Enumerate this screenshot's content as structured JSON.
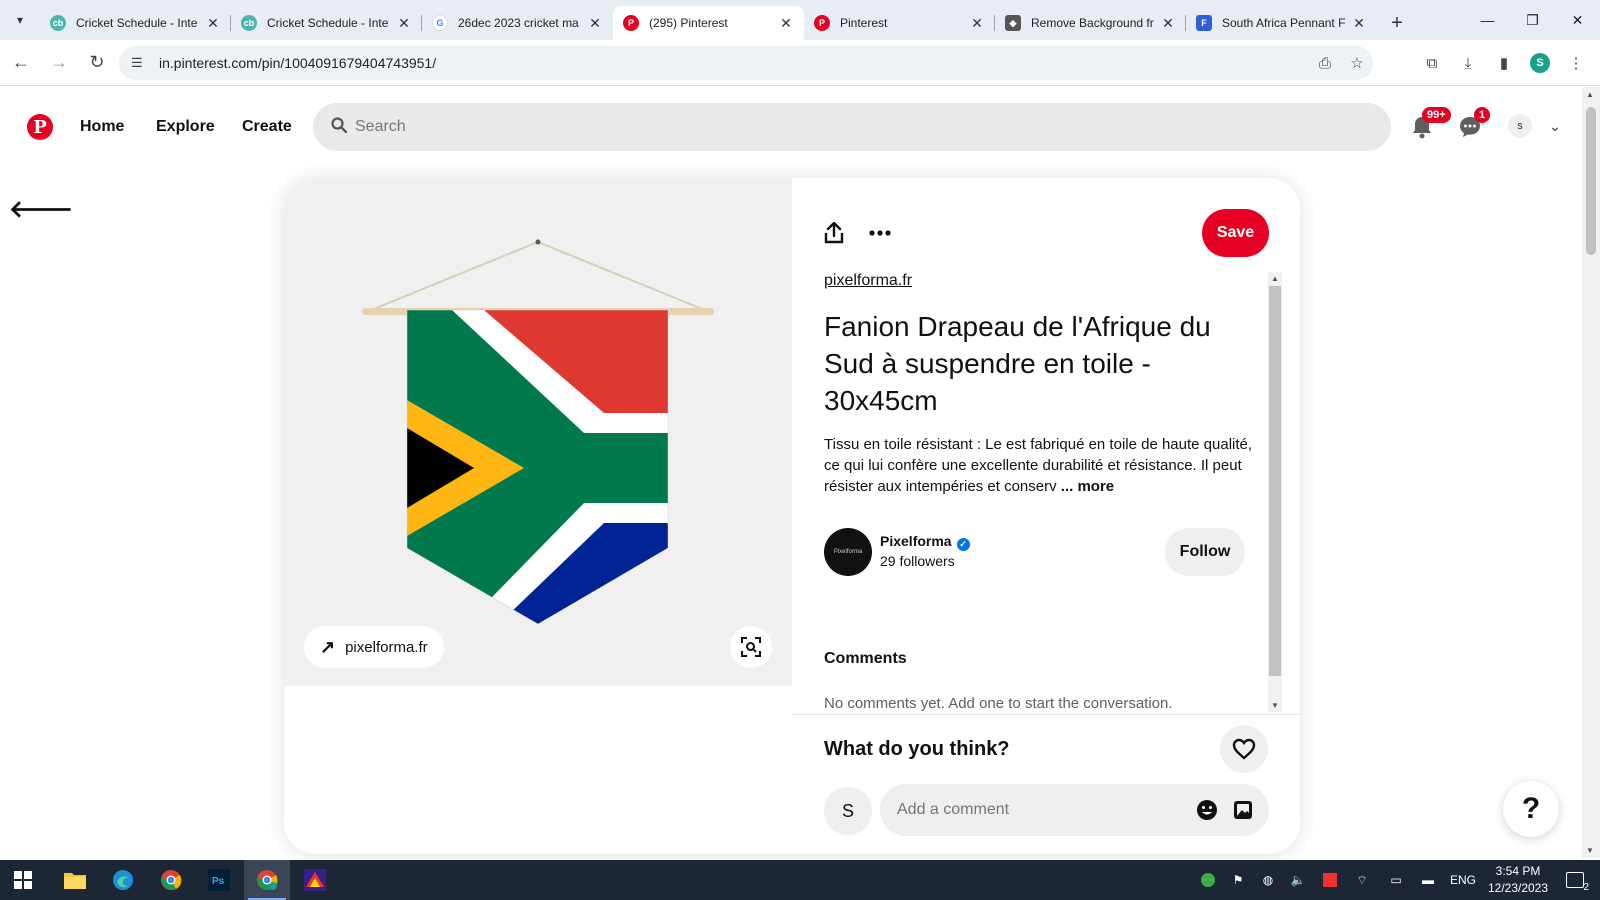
{
  "browser": {
    "tabs": [
      {
        "title": "Cricket Schedule - Inte",
        "favicon": "cricbuzz-icon",
        "active": false
      },
      {
        "title": "Cricket Schedule - Inte",
        "favicon": "cricbuzz-icon",
        "active": false
      },
      {
        "title": "26dec 2023 cricket ma",
        "favicon": "google-icon",
        "active": false
      },
      {
        "title": "(295) Pinterest",
        "favicon": "pinterest-icon",
        "active": true
      },
      {
        "title": "Pinterest",
        "favicon": "pinterest-icon",
        "active": false
      },
      {
        "title": "Remove Background fr",
        "favicon": "removebg-icon",
        "active": false
      },
      {
        "title": "South Africa Pennant F",
        "favicon": "docs-icon",
        "active": false
      }
    ],
    "url": "in.pinterest.com/pin/1004091679404743951/",
    "profile_initial": "S"
  },
  "pinterest": {
    "logo": "P",
    "nav": {
      "home": "Home",
      "explore": "Explore",
      "create": "Create"
    },
    "search_placeholder": "Search",
    "notifications_badge": "99+",
    "messages_badge": "1",
    "avatar_initial": "s"
  },
  "pin": {
    "source_button": "pixelforma.fr",
    "save_label": "Save",
    "source_link": "pixelforma.fr",
    "title": "Fanion Drapeau de l'Afrique du Sud à suspendre en toile - 30x45cm",
    "description": "Tissu en toile résistant : Le est fabriqué en toile de haute qualité, ce qui lui confère une excellente durabilité et résistance. Il peut résister aux intempéries et conserv",
    "more_label": "... more",
    "creator": {
      "name": "Pixelforma",
      "followers": "29 followers",
      "avatar_text": "Pixelforma"
    },
    "follow_label": "Follow",
    "comments_heading": "Comments",
    "no_comments": "No comments yet. Add one to start the conversation.",
    "what_do_you_think": "What do you think?",
    "my_initial": "S",
    "comment_placeholder": "Add a comment"
  },
  "help_label": "?",
  "taskbar": {
    "lang": "ENG",
    "time": "3:54 PM",
    "date": "12/23/2023",
    "notif_count": "2"
  },
  "colors": {
    "pinterest_red": "#e60023",
    "flag_red": "#de3831",
    "flag_green": "#007a4d",
    "flag_blue": "#002395",
    "flag_gold": "#ffb612"
  }
}
